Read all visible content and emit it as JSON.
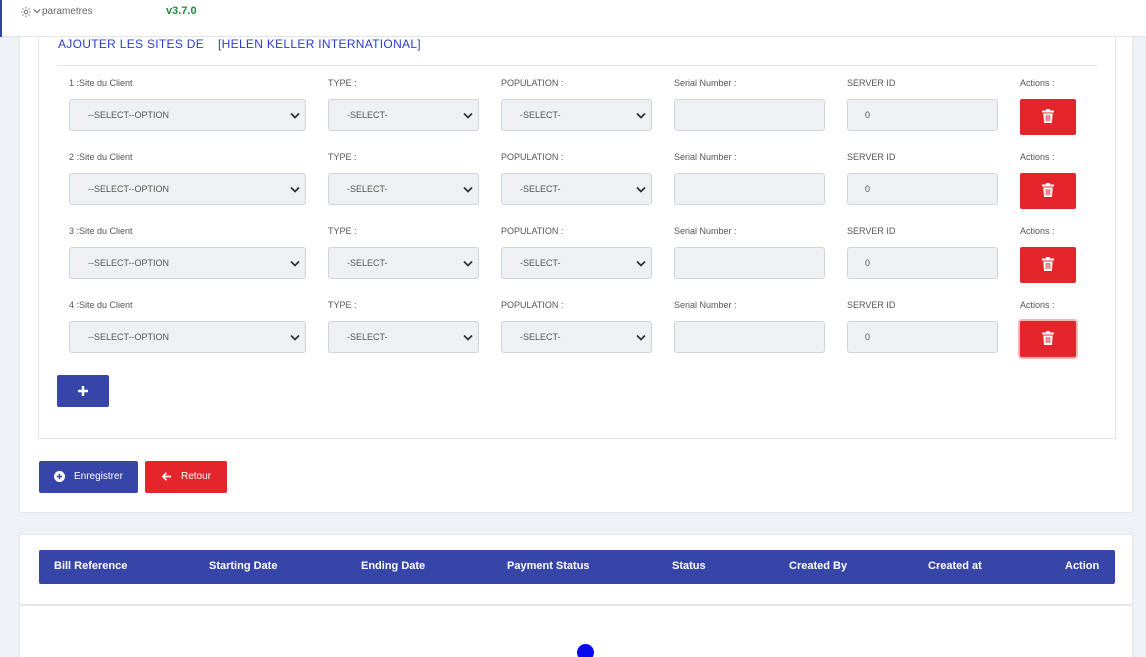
{
  "topbar": {
    "settings_label": "parametres",
    "version": "v3.7.0"
  },
  "form": {
    "title": "AJOUTER LES SITES DE",
    "organization": "[HELEN KELLER INTERNATIONAL]",
    "rows": [
      {
        "site_label": "1 :Site du Client",
        "type_label": "TYPE :",
        "population_label": "POPULATION :",
        "serial_label": "Serial Number :",
        "server_label": "SERVER ID",
        "actions_label": "Actions :",
        "site_value": "--SELECT--OPTION",
        "type_value": "-SELECT-",
        "population_value": "-SELECT-",
        "serial_value": "",
        "server_value": "0"
      },
      {
        "site_label": "2 :Site du Client",
        "type_label": "TYPE :",
        "population_label": "POPULATION :",
        "serial_label": "Serial Number :",
        "server_label": "SERVER ID",
        "actions_label": "Actions :",
        "site_value": "--SELECT--OPTION",
        "type_value": "-SELECT-",
        "population_value": "-SELECT-",
        "serial_value": "",
        "server_value": "0"
      },
      {
        "site_label": "3 :Site du Client",
        "type_label": "TYPE :",
        "population_label": "POPULATION :",
        "serial_label": "Serial Number :",
        "server_label": "SERVER ID",
        "actions_label": "Actions :",
        "site_value": "--SELECT--OPTION",
        "type_value": "-SELECT-",
        "population_value": "-SELECT-",
        "serial_value": "",
        "server_value": "0"
      },
      {
        "site_label": "4 :Site du Client",
        "type_label": "TYPE :",
        "population_label": "POPULATION :",
        "serial_label": "Serial Number :",
        "server_label": "SERVER ID",
        "actions_label": "Actions :",
        "site_value": "--SELECT--OPTION",
        "type_value": "-SELECT-",
        "population_value": "-SELECT-",
        "serial_value": "",
        "server_value": "0"
      }
    ]
  },
  "buttons": {
    "save": "Enregistrer",
    "back": "Retour"
  },
  "table": {
    "headers": [
      "Bill Reference",
      "Starting Date",
      "Ending Date",
      "Payment Status",
      "Status",
      "Created By",
      "Created at",
      "Action"
    ]
  },
  "colors": {
    "primary": "#3745a9",
    "danger": "#e3262b",
    "version": "#1f8a3a",
    "title": "#2b3bd0"
  },
  "icons": [
    "gear-icon",
    "chevron-down-icon",
    "trash-icon",
    "plus-icon",
    "plus-circle-icon",
    "arrow-left-icon",
    "loading-dot"
  ]
}
